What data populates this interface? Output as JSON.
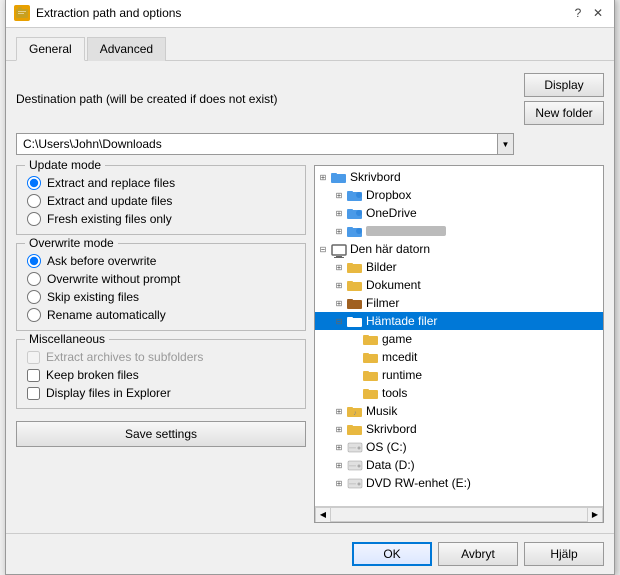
{
  "dialog": {
    "title": "Extraction path and options",
    "icon": "📦"
  },
  "tabs": [
    {
      "label": "General",
      "active": true
    },
    {
      "label": "Advanced",
      "active": false
    }
  ],
  "destination": {
    "label": "Destination path (will be created if does not exist)",
    "path": "C:\\Users\\John\\Downloads",
    "display_btn": "Display",
    "new_folder_btn": "New folder"
  },
  "update_mode": {
    "title": "Update mode",
    "options": [
      {
        "label": "Extract and replace files",
        "checked": true
      },
      {
        "label": "Extract and update files",
        "checked": false
      },
      {
        "label": "Fresh existing files only",
        "checked": false
      }
    ]
  },
  "overwrite_mode": {
    "title": "Overwrite mode",
    "options": [
      {
        "label": "Ask before overwrite",
        "checked": true
      },
      {
        "label": "Overwrite without prompt",
        "checked": false
      },
      {
        "label": "Skip existing files",
        "checked": false
      },
      {
        "label": "Rename automatically",
        "checked": false
      }
    ]
  },
  "miscellaneous": {
    "title": "Miscellaneous",
    "options": [
      {
        "label": "Extract archives to subfolders",
        "checked": false,
        "disabled": true
      },
      {
        "label": "Keep broken files",
        "checked": false,
        "disabled": false
      },
      {
        "label": "Display files in Explorer",
        "checked": false,
        "disabled": false
      }
    ]
  },
  "save_settings_btn": "Save settings",
  "tree": {
    "items": [
      {
        "label": "Skrivbord",
        "level": 0,
        "icon": "folder-blue",
        "expanded": false,
        "has_children": true,
        "selected": false
      },
      {
        "label": "Dropbox",
        "level": 1,
        "icon": "folder-special",
        "expanded": false,
        "has_children": true,
        "selected": false
      },
      {
        "label": "OneDrive",
        "level": 1,
        "icon": "folder-special",
        "expanded": false,
        "has_children": true,
        "selected": false
      },
      {
        "label": "BLURRED",
        "level": 1,
        "icon": "folder-special",
        "expanded": false,
        "has_children": true,
        "selected": false,
        "blurred": true
      },
      {
        "label": "Den här datorn",
        "level": 0,
        "icon": "computer",
        "expanded": true,
        "has_children": true,
        "selected": false
      },
      {
        "label": "Bilder",
        "level": 1,
        "icon": "folder-yellow",
        "expanded": false,
        "has_children": true,
        "selected": false
      },
      {
        "label": "Dokument",
        "level": 1,
        "icon": "folder-yellow",
        "expanded": false,
        "has_children": true,
        "selected": false
      },
      {
        "label": "Filmer",
        "level": 1,
        "icon": "folder-special2",
        "expanded": false,
        "has_children": true,
        "selected": false
      },
      {
        "label": "Hämtade filer",
        "level": 1,
        "icon": "folder-blue",
        "expanded": true,
        "has_children": true,
        "selected": true
      },
      {
        "label": "game",
        "level": 2,
        "icon": "folder-yellow",
        "expanded": false,
        "has_children": false,
        "selected": false
      },
      {
        "label": "mcedit",
        "level": 2,
        "icon": "folder-yellow",
        "expanded": false,
        "has_children": false,
        "selected": false
      },
      {
        "label": "runtime",
        "level": 2,
        "icon": "folder-yellow",
        "expanded": false,
        "has_children": false,
        "selected": false
      },
      {
        "label": "tools",
        "level": 2,
        "icon": "folder-yellow",
        "expanded": false,
        "has_children": false,
        "selected": false
      },
      {
        "label": "Musik",
        "level": 1,
        "icon": "folder-music",
        "expanded": false,
        "has_children": true,
        "selected": false
      },
      {
        "label": "Skrivbord",
        "level": 1,
        "icon": "folder-yellow",
        "expanded": false,
        "has_children": true,
        "selected": false
      },
      {
        "label": "OS (C:)",
        "level": 1,
        "icon": "drive",
        "expanded": false,
        "has_children": true,
        "selected": false
      },
      {
        "label": "Data (D:)",
        "level": 1,
        "icon": "drive",
        "expanded": false,
        "has_children": true,
        "selected": false
      },
      {
        "label": "DVD RW-enhet (E:)",
        "level": 1,
        "icon": "drive",
        "expanded": false,
        "has_children": true,
        "selected": false
      }
    ]
  },
  "footer": {
    "ok_btn": "OK",
    "cancel_btn": "Avbryt",
    "help_btn": "Hjälp"
  }
}
